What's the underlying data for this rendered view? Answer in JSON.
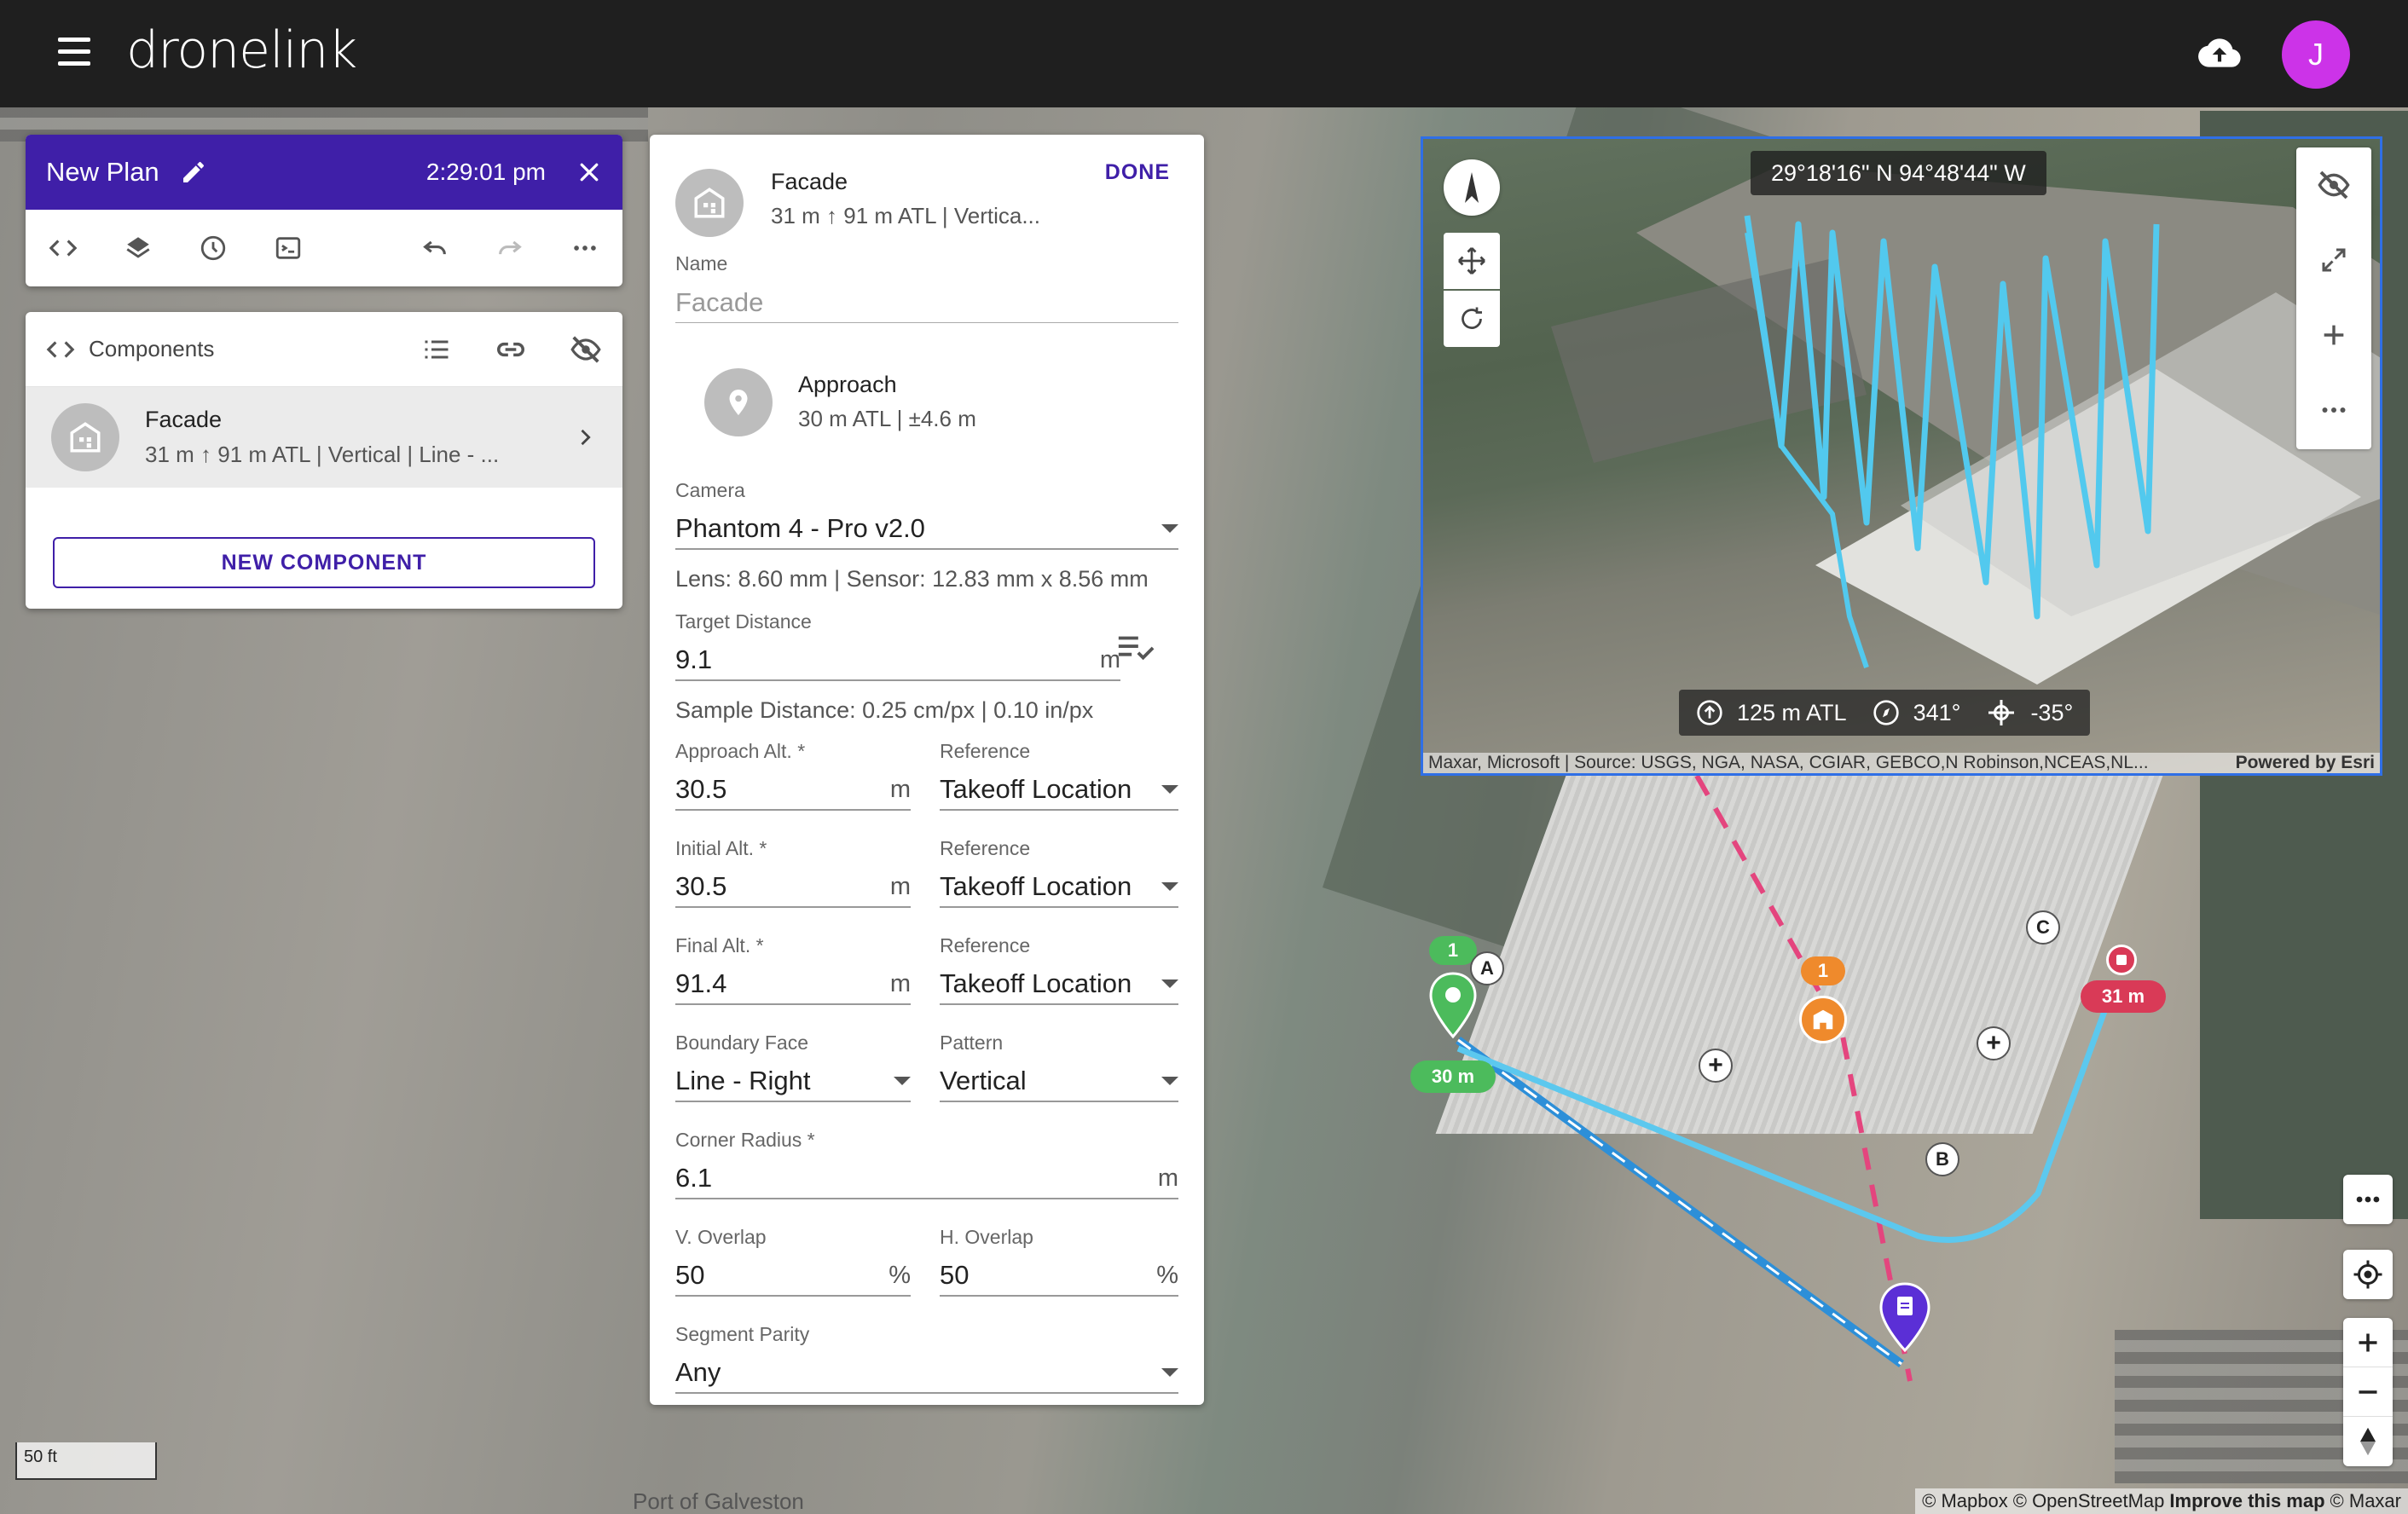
{
  "app": {
    "logo": "dronelink",
    "avatar_initial": "J",
    "accent": "#3f1fa8",
    "avatar_color": "#cc33e8"
  },
  "plan": {
    "title": "New Plan",
    "time": "2:29:01 pm"
  },
  "components": {
    "header": "Components",
    "item": {
      "title": "Facade",
      "subtitle": "31 m ↑ 91 m ATL | Vertical | Line - ..."
    },
    "new_button": "NEW COMPONENT"
  },
  "facade": {
    "title": "Facade",
    "subtitle": "31 m ↑ 91 m ATL | Vertica...",
    "done": "DONE",
    "name_label": "Name",
    "name_value": "Facade",
    "approach": {
      "title": "Approach",
      "subtitle": "30 m ATL | ±4.6 m"
    },
    "camera_label": "Camera",
    "camera_value": "Phantom 4 - Pro v2.0",
    "lens_info": "Lens: 8.60 mm | Sensor: 12.83 mm x 8.56 mm",
    "target_distance_label": "Target Distance",
    "target_distance_value": "9.1",
    "sample_distance": "Sample Distance: 0.25 cm/px | 0.10 in/px",
    "approach_alt_label": "Approach Alt. *",
    "approach_alt_value": "30.5",
    "initial_alt_label": "Initial Alt. *",
    "initial_alt_value": "30.5",
    "final_alt_label": "Final Alt. *",
    "final_alt_value": "91.4",
    "reference_label": "Reference",
    "reference_value": "Takeoff Location",
    "boundary_face_label": "Boundary Face",
    "boundary_face_value": "Line - Right",
    "pattern_label": "Pattern",
    "pattern_value": "Vertical",
    "corner_radius_label": "Corner Radius *",
    "corner_radius_value": "6.1",
    "v_overlap_label": "V. Overlap",
    "v_overlap_value": "50",
    "h_overlap_label": "H. Overlap",
    "h_overlap_value": "50",
    "segment_parity_label": "Segment Parity",
    "segment_parity_value": "Any",
    "unit_m": "m",
    "unit_pct": "%"
  },
  "preview": {
    "coords": "29°18'16\" N 94°48'44\" W",
    "altitude": "125 m ATL",
    "heading": "341°",
    "gimbal": "-35°",
    "attribution_left": "Maxar, Microsoft | Source: USGS, NGA, NASA, CGIAR, GEBCO,N Robinson,NCEAS,NL...",
    "attribution_right": "Powered by Esri"
  },
  "map": {
    "scale": "50 ft",
    "place_label": "Port of Galveston",
    "attribution": [
      "© Mapbox",
      "© OpenStreetMap",
      "Improve this map",
      "© Maxar"
    ],
    "marker_start_count": "1",
    "marker_component_count": "1",
    "start_alt": "30 m",
    "end_alt": "31 m",
    "waypoints": [
      "A",
      "B",
      "C"
    ],
    "start_color": "#4cbb5c",
    "component_color": "#ef8a2c",
    "end_color": "#d93a57"
  }
}
